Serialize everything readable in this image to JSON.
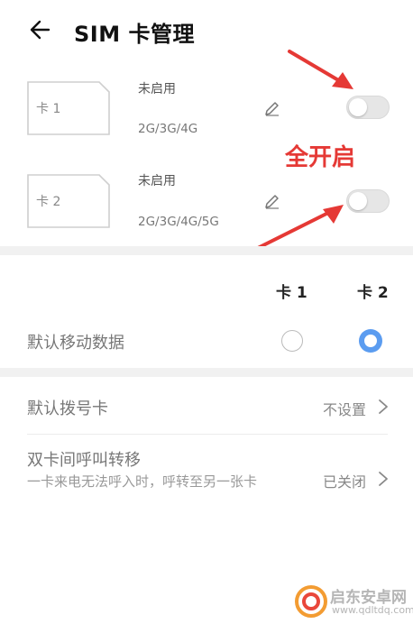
{
  "header": {
    "title": "SIM 卡管理"
  },
  "sim1": {
    "card_label": "卡 1",
    "status": "未启用",
    "network": "2G/3G/4G"
  },
  "sim2": {
    "card_label": "卡 2",
    "status": "未启用",
    "network": "2G/3G/4G/5G"
  },
  "annotation": "全开启",
  "columns": {
    "sim1": "卡 1",
    "sim2": "卡 2"
  },
  "default_data": {
    "label": "默认移动数据",
    "selected": "卡 2"
  },
  "default_dial": {
    "label": "默认拨号卡",
    "value": "不设置"
  },
  "call_forward": {
    "label": "双卡间呼叫转移",
    "sub": "一卡来电无法呼入时，呼转至另一张卡",
    "value": "已关闭"
  },
  "watermark": {
    "name": "启东安卓网",
    "url": "www.qdltdq.com"
  },
  "colors": {
    "accent": "#5b9cf0",
    "annotation": "#e53935",
    "toggle_off": "#e6e6e6"
  }
}
